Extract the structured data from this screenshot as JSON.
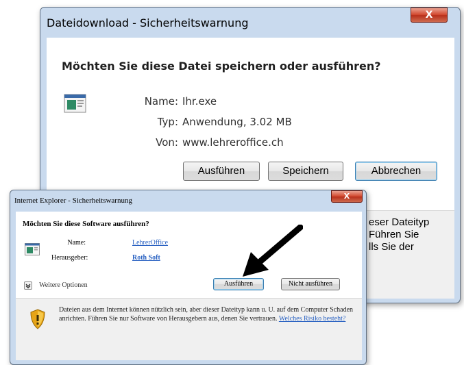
{
  "download_dialog": {
    "title": "Dateidownload - Sicherheitswarnung",
    "heading": "Möchten Sie diese Datei speichern oder ausführen?",
    "name_label": "Name:",
    "name_value": "Ihr.exe",
    "type_label": "Typ:",
    "type_value": "Anwendung, 3.02 MB",
    "from_label": "Von:",
    "from_value": "www.lehreroffice.ch",
    "run_button": "Ausführen",
    "save_button": "Speichern",
    "cancel_button": "Abbrechen",
    "footer_lines": [
      "eser Dateityp",
      "Führen Sie",
      "lls Sie der"
    ],
    "close_glyph": "X"
  },
  "ie_dialog": {
    "title": "Internet Explorer - Sicherheitswarnung",
    "heading": "Möchten Sie diese Software ausführen?",
    "name_label": "Name:",
    "name_value": "LehrerOffice",
    "publisher_label": "Herausgeber:",
    "publisher_value": "Roth Soft",
    "more_options_label": "Weitere Optionen",
    "run_button": "Ausführen",
    "dont_run_button": "Nicht ausführen",
    "warning_text": "Dateien aus dem Internet können nützlich sein, aber dieser Dateityp kann u. U. auf dem Computer Schaden anrichten. Führen Sie nur Software von Herausgebern aus, denen Sie vertrauen.",
    "risk_link": "Welches Risiko besteht?",
    "close_glyph": "X"
  },
  "colors": {
    "window_frame": "#c9daee",
    "link": "#2a62c2",
    "close_button": "#c4412a",
    "shield_gold": "#e6a417",
    "arrow": "#000000"
  },
  "icons": [
    "application-file-icon",
    "close-icon",
    "shield-warning-icon",
    "expand-icon",
    "pointer-arrow"
  ]
}
